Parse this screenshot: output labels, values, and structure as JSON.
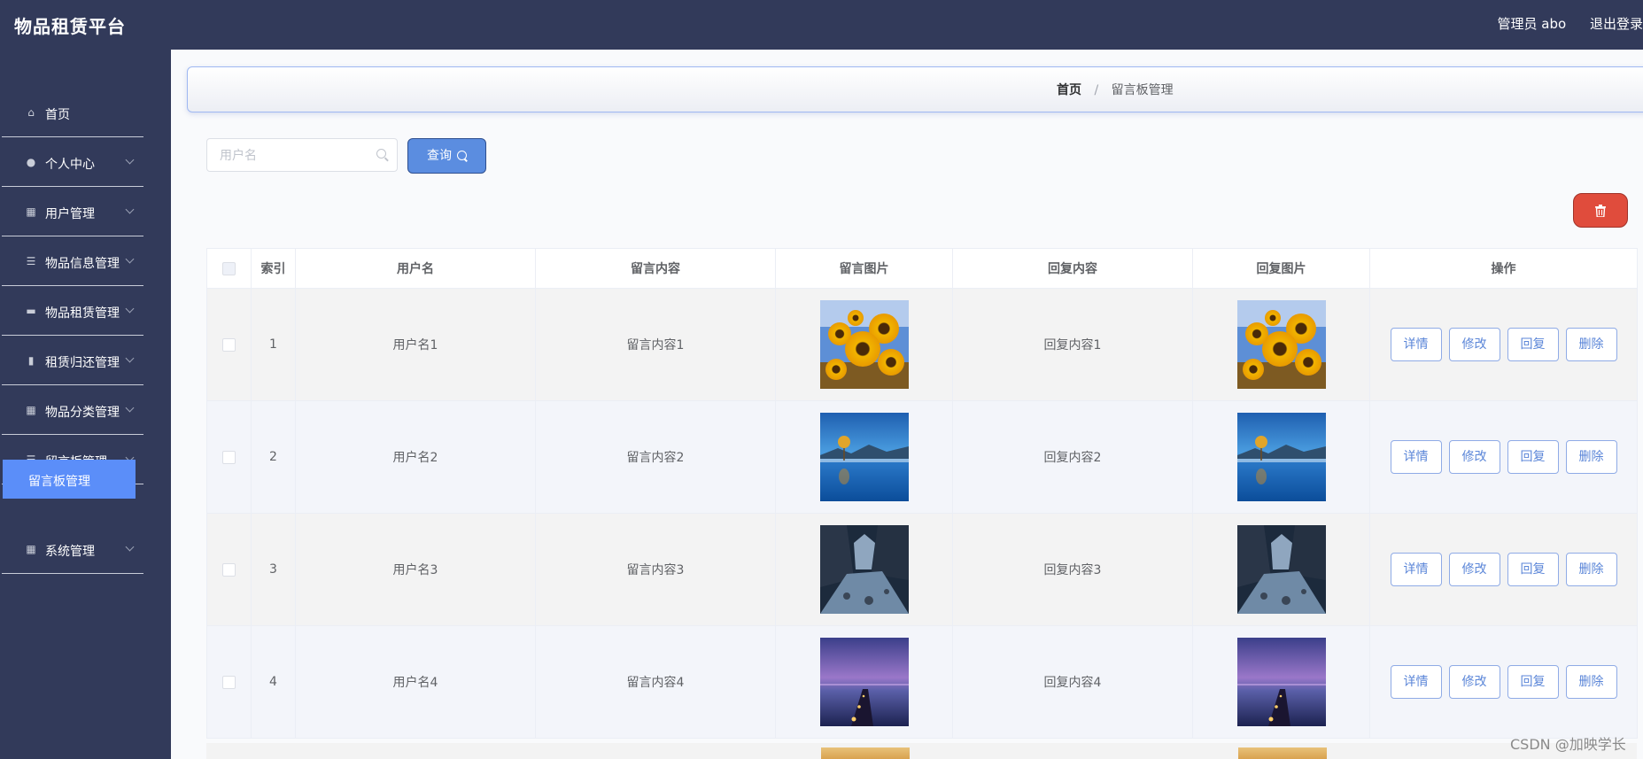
{
  "app": {
    "title": "物品租赁平台"
  },
  "header": {
    "admin_label": "管理员 abo",
    "logout_label": "退出登录"
  },
  "sidebar": {
    "items": [
      {
        "label": "首页",
        "icon": "home-icon",
        "expandable": false
      },
      {
        "label": "个人中心",
        "icon": "user-icon",
        "expandable": true
      },
      {
        "label": "用户管理",
        "icon": "grid-icon",
        "expandable": true
      },
      {
        "label": "物品信息管理",
        "icon": "list-icon",
        "expandable": true
      },
      {
        "label": "物品租赁管理",
        "icon": "monitor-icon",
        "expandable": true
      },
      {
        "label": "租赁归还管理",
        "icon": "bar-chart-icon",
        "expandable": true
      },
      {
        "label": "物品分类管理",
        "icon": "grid-icon",
        "expandable": true
      },
      {
        "label": "留言板管理",
        "icon": "list-icon",
        "expandable": true
      },
      {
        "label": "系统管理",
        "icon": "grid-icon",
        "expandable": true
      }
    ],
    "active_sub_item": "留言板管理"
  },
  "breadcrumb": {
    "home": "首页",
    "separator": "/",
    "current": "留言板管理"
  },
  "search": {
    "placeholder": "用户名",
    "value": "",
    "query_label": "查询"
  },
  "table": {
    "columns": [
      "",
      "索引",
      "用户名",
      "留言内容",
      "留言图片",
      "回复内容",
      "回复图片",
      "操作"
    ],
    "rows": [
      {
        "index": "1",
        "username": "用户名1",
        "content": "留言内容1",
        "image": "sunflower-image",
        "reply": "回复内容1",
        "reply_image": "sunflower-image"
      },
      {
        "index": "2",
        "username": "用户名2",
        "content": "留言内容2",
        "image": "lake-tree-image",
        "reply": "回复内容2",
        "reply_image": "lake-tree-image"
      },
      {
        "index": "3",
        "username": "用户名3",
        "content": "留言内容3",
        "image": "river-valley-image",
        "reply": "回复内容3",
        "reply_image": "river-valley-image"
      },
      {
        "index": "4",
        "username": "用户名4",
        "content": "留言内容4",
        "image": "pier-dusk-image",
        "reply": "回复内容4",
        "reply_image": "pier-dusk-image"
      }
    ],
    "actions": [
      "详情",
      "修改",
      "回复",
      "删除"
    ]
  },
  "watermark": "CSDN @加映学长",
  "colors": {
    "sidebar": "#323a5a",
    "accent": "#5b8ef9",
    "danger": "#e04c3c"
  }
}
